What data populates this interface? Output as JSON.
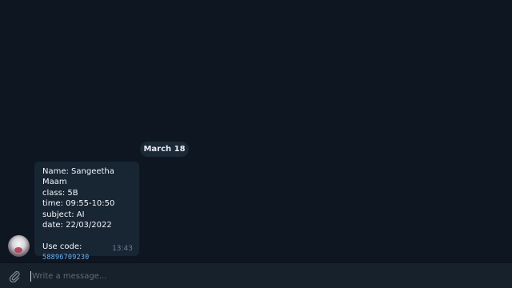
{
  "chat": {
    "date_separator": "March 18",
    "message": {
      "lines": [
        "Name: Sangeetha Maam",
        "class: 5B",
        "time: 09:55-10:50",
        "subject: AI",
        "date: 22/03/2022"
      ],
      "use_code_label": "Use code:",
      "code": "58896709230",
      "time": "13:43"
    }
  },
  "composer": {
    "placeholder": "Write a message..."
  },
  "icons": {
    "attach": "paperclip-icon",
    "avatar": "user-avatar"
  },
  "colors": {
    "background": "#0e1621",
    "bubble": "#182533",
    "link": "#6ab3f3",
    "composer": "#17212b"
  }
}
